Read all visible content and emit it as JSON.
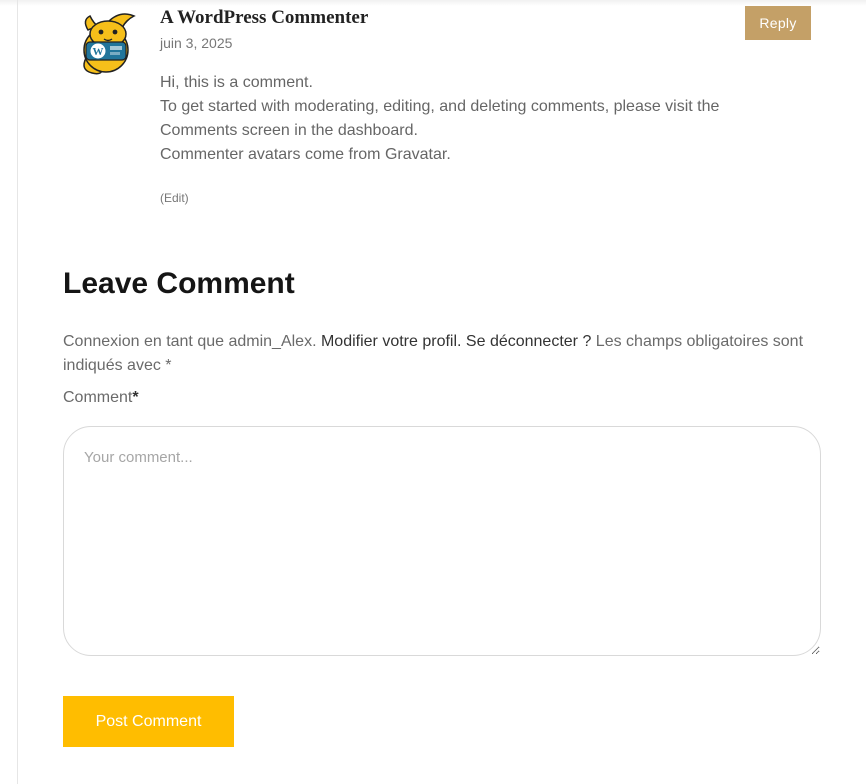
{
  "comment": {
    "author": "A WordPress Commenter",
    "date": "juin 3, 2025",
    "reply_label": "Reply",
    "body_lines": [
      "Hi, this is a comment.",
      "To get started with moderating, editing, and deleting comments, please visit the Comments screen in the dashboard.",
      "Commenter avatars come from Gravatar."
    ],
    "edit_label": "(Edit)",
    "avatar_icon": "wapuu-avatar-icon"
  },
  "respond": {
    "title": "Leave Comment",
    "logged_in_prefix": "Connexion en tant que admin_Alex.",
    "edit_profile_link": "Modifier votre profil.",
    "logout_link": "Se déconnecter ?",
    "required_note": "Les champs obligatoires sont indiqués avec",
    "required_marker": "*",
    "comment_label": "Comment",
    "comment_required": "*",
    "comment_placeholder": "Your comment...",
    "submit_label": "Post Comment"
  },
  "colors": {
    "reply_button": "#c4a067",
    "submit_button": "#ffbd00"
  }
}
